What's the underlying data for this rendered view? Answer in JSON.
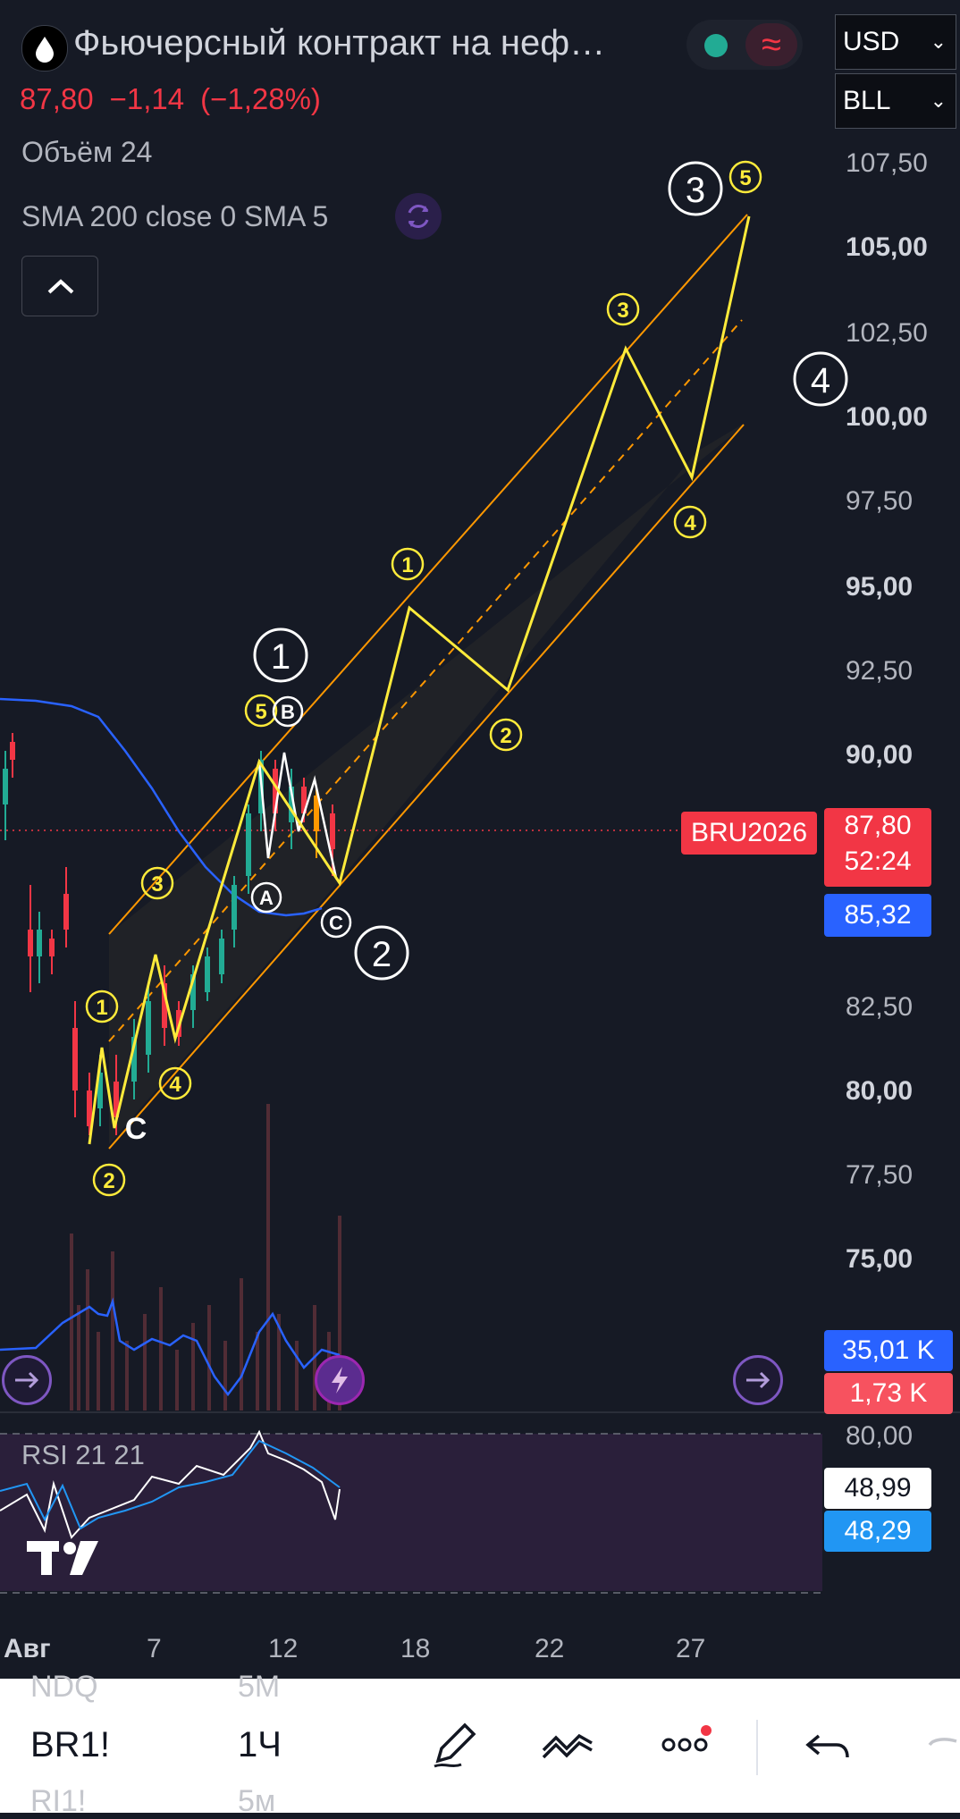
{
  "header": {
    "title": "Фьючерсный контракт на неф…",
    "currency": "USD",
    "unit": "BLL",
    "price": "87,80",
    "change": "−1,14",
    "change_pct": "(−1,28%)",
    "volume_label": "Объём 24",
    "sma_label": "SMA 200 close 0 SMA 5"
  },
  "price_axis": {
    "labels": [
      "107,50",
      "105,00",
      "102,50",
      "100,00",
      "97,50",
      "95,00",
      "92,50",
      "90,00",
      "82,50",
      "80,00",
      "77,50",
      "75,00"
    ],
    "bold": [
      "105,00",
      "100,00",
      "95,00",
      "90,00",
      "80,00",
      "75,00"
    ]
  },
  "tags": {
    "ticker": "BRU2026",
    "last_price": "87,80",
    "countdown": "52:24",
    "sma_value": "85,32",
    "vol1": "35,01 K",
    "vol2": "1,73 K",
    "rsi_value": "48,99",
    "rsi_sma": "48,29"
  },
  "rsi": {
    "label": "RSI 21 21",
    "level": "80,00"
  },
  "time_axis": [
    "Авг",
    "7",
    "12",
    "18",
    "22",
    "27"
  ],
  "wave_labels": {
    "big": [
      "1",
      "2",
      "3",
      "4"
    ],
    "small": [
      "1",
      "2",
      "3",
      "4",
      "5"
    ],
    "abc": [
      "A",
      "B",
      "C"
    ],
    "c_letter": "C"
  },
  "bottom": {
    "symbols": [
      {
        "sym": "NDQ",
        "tf": "5M"
      },
      {
        "sym": "BR1!",
        "tf": "1Ч"
      },
      {
        "sym": "RI1!",
        "tf": "5м"
      }
    ]
  },
  "colors": {
    "up": "#22ab94",
    "down": "#f23645",
    "wave": "#ffeb3b",
    "channel": "#ff9800",
    "sma": "#2962ff"
  }
}
